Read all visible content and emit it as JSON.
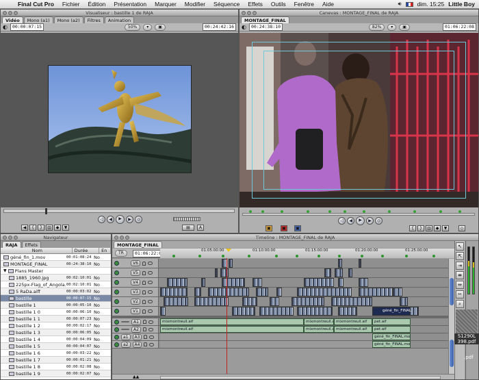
{
  "menubar": {
    "app": "Final Cut Pro",
    "items": [
      "Fichier",
      "Édition",
      "Présentation",
      "Marquer",
      "Modifier",
      "Séquence",
      "Effets",
      "Outils",
      "Fenêtre",
      "Aide"
    ],
    "clock": "dim. 15:25",
    "user": "Little Boy"
  },
  "viewer": {
    "title": "Visualiseur : bastille 1 de RAJA",
    "tabs": [
      "Vidéo",
      "Mono (a1)",
      "Mono (a2)",
      "Filtres",
      "Animation"
    ],
    "duration_tc": "00:00:07:15",
    "zoom": "50%",
    "current_tc": "00:24:42:16"
  },
  "canvas": {
    "title": "Canevas : MONTAGE_FINAL de RAJA",
    "tab": "MONTAGE_FINAL",
    "duration_tc": "00:24:38:10",
    "zoom": "82%",
    "current_tc": "01:06:22:08"
  },
  "browser": {
    "title": "Navigateur",
    "tabs": [
      "RAJA",
      "Effets"
    ],
    "columns": [
      "Nom",
      "Durée",
      "En"
    ],
    "rows": [
      {
        "name": "géné_fin_1.mov",
        "dur": "00:01:08:24",
        "x": "No",
        "kind": "clip"
      },
      {
        "name": "MONTAGE_FINAL",
        "dur": "00:24:38:10",
        "x": "No",
        "kind": "seq"
      },
      {
        "name": "Plans Master",
        "dur": "",
        "x": "",
        "kind": "bin"
      },
      {
        "name": "1885_1960.jpg",
        "dur": "00:02:10:01",
        "x": "No",
        "kind": "img"
      },
      {
        "name": "225px-Flag_of_Angola.svg.png",
        "dur": "00:02:10:01",
        "x": "No",
        "kind": "img"
      },
      {
        "name": "5 RaDa.aiff",
        "dur": "00:00:03:02",
        "x": "No",
        "kind": "audio"
      },
      {
        "name": "bastille",
        "dur": "00:00:07:15",
        "x": "No",
        "kind": "clip",
        "selected": true
      },
      {
        "name": "bastille 1",
        "dur": "00:00:05:10",
        "x": "No",
        "kind": "clip"
      },
      {
        "name": "bastille 1 0",
        "dur": "00:00:06:10",
        "x": "No",
        "kind": "clip"
      },
      {
        "name": "bastille 1 1",
        "dur": "00:00:07:23",
        "x": "No",
        "kind": "clip"
      },
      {
        "name": "bastille 1 2",
        "dur": "00:00:02:17",
        "x": "No",
        "kind": "clip"
      },
      {
        "name": "bastille 1 3",
        "dur": "00:00:06:05",
        "x": "No",
        "kind": "clip"
      },
      {
        "name": "bastille 1 4",
        "dur": "00:00:04:09",
        "x": "No",
        "kind": "clip"
      },
      {
        "name": "bastille 1 5",
        "dur": "00:00:04:07",
        "x": "No",
        "kind": "clip"
      },
      {
        "name": "bastille 1 6",
        "dur": "00:00:03:22",
        "x": "No",
        "kind": "clip"
      },
      {
        "name": "bastille 1 7",
        "dur": "00:00:01:21",
        "x": "No",
        "kind": "clip"
      },
      {
        "name": "bastille 1 8",
        "dur": "00:00:02:08",
        "x": "No",
        "kind": "clip"
      },
      {
        "name": "bastille 1 9",
        "dur": "00:00:02:07",
        "x": "No",
        "kind": "clip"
      }
    ]
  },
  "timeline": {
    "title": "Timeline : MONTAGE_FINAL de RAJA",
    "tab": "MONTAGE_FINAL",
    "current_tc": "01:06:22:08",
    "tr_label": "TR",
    "ruler": [
      "01:05:00:00",
      "01:10:00:00",
      "01:15:00:00",
      "01:20:00:00",
      "01:25:00:00"
    ],
    "video_tracks": [
      "V6",
      "V5",
      "V4",
      "V3",
      "V2",
      "V1"
    ],
    "audio_tracks": [
      {
        "src": "",
        "dst": "A1"
      },
      {
        "src": "",
        "dst": "A2"
      },
      {
        "src": "a1",
        "dst": "A3"
      },
      {
        "src": "a2",
        "dst": "A4"
      }
    ],
    "clip_labels": {
      "mixmontreuil": "mixmontreuil.aif",
      "pet": "pet.aif",
      "gene": "géné_fin_FINAL",
      "gene_mov": "géné_fin_FINAL.mov"
    }
  },
  "desktop": {
    "file_label": "S1290L 398.pdf",
    "pdf": ".pdf"
  }
}
